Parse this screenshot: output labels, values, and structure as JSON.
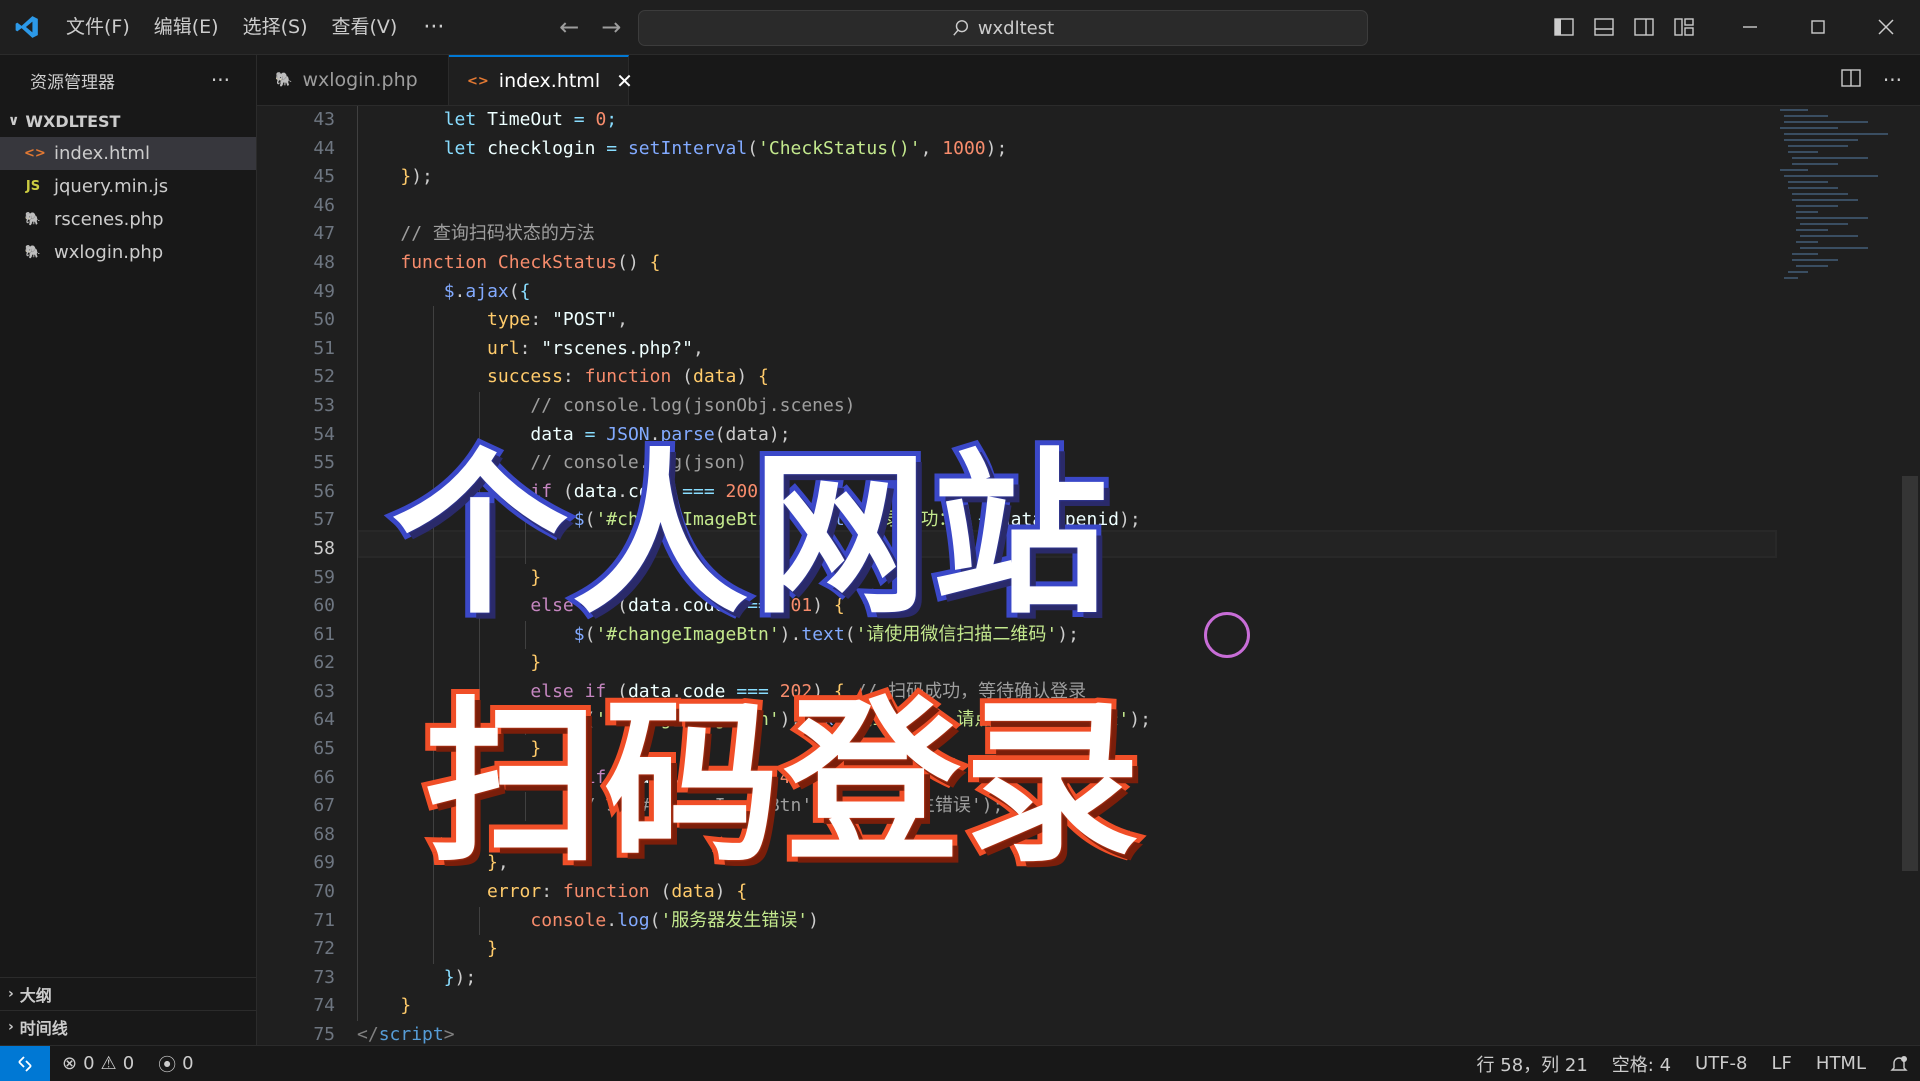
{
  "titlebar": {
    "menus": [
      "文件(F)",
      "编辑(E)",
      "选择(S)",
      "查看(V)"
    ],
    "more": "···",
    "search_text": "wxdltest"
  },
  "sidebar": {
    "title": "资源管理器",
    "more": "···",
    "folder": "WXDLTEST",
    "files": [
      {
        "name": "index.html",
        "icon": "html-icon",
        "active": true
      },
      {
        "name": "jquery.min.js",
        "icon": "js-icon",
        "active": false
      },
      {
        "name": "rscenes.php",
        "icon": "php-icon",
        "active": false
      },
      {
        "name": "wxlogin.php",
        "icon": "php-icon",
        "active": false
      }
    ],
    "outline": "大纲",
    "timeline": "时间线"
  },
  "tabs": [
    {
      "label": "wxlogin.php",
      "active": false
    },
    {
      "label": "index.html",
      "active": true
    }
  ],
  "editor": {
    "active_line": 58,
    "lines": [
      {
        "n": 43
      },
      {
        "n": 44
      },
      {
        "n": 45
      },
      {
        "n": 46
      },
      {
        "n": 47
      },
      {
        "n": 48
      },
      {
        "n": 49
      },
      {
        "n": 50
      },
      {
        "n": 51
      },
      {
        "n": 52
      },
      {
        "n": 53
      },
      {
        "n": 54
      },
      {
        "n": 55
      },
      {
        "n": 56
      },
      {
        "n": 57
      },
      {
        "n": 58
      },
      {
        "n": 59
      },
      {
        "n": 60
      },
      {
        "n": 61
      },
      {
        "n": 62
      },
      {
        "n": 63
      },
      {
        "n": 64
      },
      {
        "n": 65
      },
      {
        "n": 66
      },
      {
        "n": 67
      },
      {
        "n": 68
      },
      {
        "n": 69
      },
      {
        "n": 70
      },
      {
        "n": 71
      },
      {
        "n": 72
      },
      {
        "n": 73
      },
      {
        "n": 74
      },
      {
        "n": 75
      }
    ]
  },
  "overlay": {
    "title": "个人网站",
    "subtitle": "扫码登录"
  },
  "statusbar": {
    "errors": "0",
    "warnings": "0",
    "ports": "0",
    "position": "行 58，列 21",
    "indent": "空格: 4",
    "encoding": "UTF-8",
    "eol": "LF",
    "language": "HTML"
  },
  "colors": {
    "accent": "#0078d4",
    "title_stroke": "#3b48c8",
    "subtitle_stroke": "#f04f28",
    "cursor_ring": "#c86dd7"
  }
}
